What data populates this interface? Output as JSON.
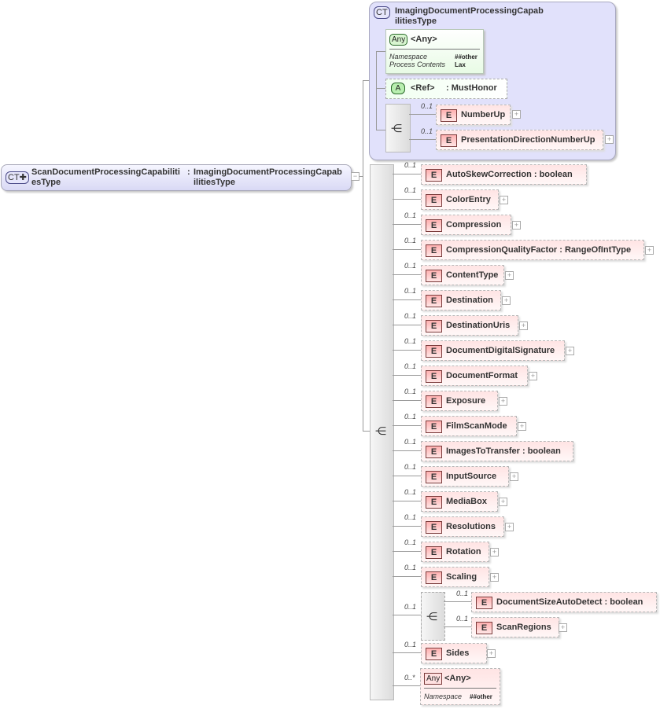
{
  "root": {
    "badge": "CT",
    "name_line1": "ScanDocumentProcessingCapabiliti",
    "name_line2": "esType",
    "sep": ":",
    "type_line1": "ImagingDocumentProcessingCapab",
    "type_line2": "ilitiesType",
    "collapse_symbol": "−"
  },
  "base_type": {
    "badge": "CT",
    "name_line1": "ImagingDocumentProcessingCapab",
    "name_line2": "ilitiesType",
    "any": {
      "badge": "Any",
      "label": "<Any>",
      "props": [
        {
          "key": "Namespace",
          "value": "##other"
        },
        {
          "key": "Process Contents",
          "value": "Lax"
        }
      ]
    },
    "attribute": {
      "badge": "A",
      "label": "<Ref>",
      "type": ": MustHonor"
    },
    "sequence_items": [
      {
        "occurs": "0..1",
        "badge": "E",
        "label": "NumberUp",
        "expandable": true
      },
      {
        "occurs": "0..1",
        "badge": "E",
        "label": "PresentationDirectionNumberUp",
        "expandable": true
      }
    ]
  },
  "elements": [
    {
      "occurs": "0..1",
      "badge": "E",
      "label": "AutoSkewCorrection : boolean",
      "expandable": false
    },
    {
      "occurs": "0..1",
      "badge": "E",
      "label": "ColorEntry",
      "expandable": true
    },
    {
      "occurs": "0..1",
      "badge": "E",
      "label": "Compression",
      "expandable": true
    },
    {
      "occurs": "0..1",
      "badge": "E",
      "label": "CompressionQualityFactor : RangeOfIntType",
      "expandable": true
    },
    {
      "occurs": "0..1",
      "badge": "E",
      "label": "ContentType",
      "expandable": true
    },
    {
      "occurs": "0..1",
      "badge": "E",
      "label": "Destination",
      "expandable": true
    },
    {
      "occurs": "0..1",
      "badge": "E",
      "label": "DestinationUris",
      "expandable": true
    },
    {
      "occurs": "0..1",
      "badge": "E",
      "label": "DocumentDigitalSignature",
      "expandable": true
    },
    {
      "occurs": "0..1",
      "badge": "E",
      "label": "DocumentFormat",
      "expandable": true
    },
    {
      "occurs": "0..1",
      "badge": "E",
      "label": "Exposure",
      "expandable": true
    },
    {
      "occurs": "0..1",
      "badge": "E",
      "label": "FilmScanMode",
      "expandable": true
    },
    {
      "occurs": "0..1",
      "badge": "E",
      "label": "ImagesToTransfer : boolean",
      "expandable": false
    },
    {
      "occurs": "0..1",
      "badge": "E",
      "label": "InputSource",
      "expandable": true
    },
    {
      "occurs": "0..1",
      "badge": "E",
      "label": "MediaBox",
      "expandable": true
    },
    {
      "occurs": "0..1",
      "badge": "E",
      "label": "Resolutions",
      "expandable": true
    },
    {
      "occurs": "0..1",
      "badge": "E",
      "label": "Rotation",
      "expandable": true
    },
    {
      "occurs": "0..1",
      "badge": "E",
      "label": "Scaling",
      "expandable": true
    }
  ],
  "inner_sequence": {
    "occurs": "0..1",
    "items": [
      {
        "occurs": "0..1",
        "badge": "E",
        "label": "DocumentSizeAutoDetect : boolean",
        "expandable": false
      },
      {
        "occurs": "0..1",
        "badge": "E",
        "label": "ScanRegions",
        "expandable": true
      }
    ]
  },
  "sides": {
    "occurs": "0..1",
    "badge": "E",
    "label": "Sides",
    "expandable": true
  },
  "any_bottom": {
    "occurs": "0..*",
    "badge": "Any",
    "label": "<Any>",
    "props": [
      {
        "key": "Namespace",
        "value": "##other"
      }
    ]
  },
  "plus_symbol": "+"
}
